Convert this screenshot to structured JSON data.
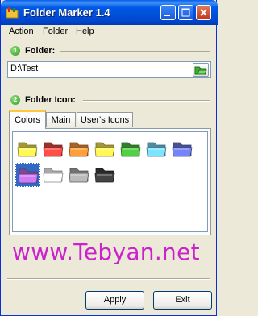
{
  "window": {
    "title": "Folder Marker 1.4"
  },
  "menu": [
    "Action",
    "Folder",
    "Help"
  ],
  "folder_section": {
    "step": "1",
    "label": "Folder:",
    "path": "D:\\Test"
  },
  "icon_section": {
    "step": "2",
    "label": "Folder Icon:"
  },
  "tabs": [
    "Colors",
    "Main",
    "User's Icons"
  ],
  "active_tab": "Colors",
  "folder_colors": [
    "#e8d84a",
    "#e0453d",
    "#ee8a33",
    "#e8d84a",
    "#46b53a",
    "#6cc6e6",
    "#6673d6",
    "#b46ad6",
    "#f2f2f2",
    "#a3a3a3",
    "#3a3a3a"
  ],
  "selected_color_index": 7,
  "watermark": "www.Tebyan.net",
  "buttons": {
    "apply": "Apply",
    "exit": "Exit"
  }
}
